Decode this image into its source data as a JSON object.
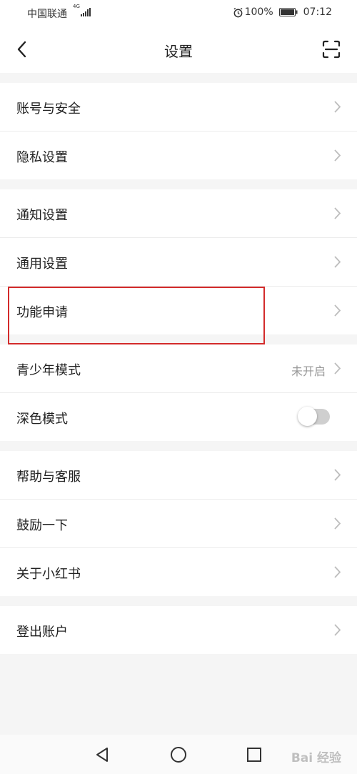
{
  "status_bar": {
    "carrier": "中国联通",
    "network": "4G",
    "battery": "100%",
    "time": "07:12"
  },
  "header": {
    "title": "设置"
  },
  "groups": [
    {
      "items": [
        {
          "label": "账号与安全"
        },
        {
          "label": "隐私设置"
        }
      ]
    },
    {
      "items": [
        {
          "label": "通知设置"
        },
        {
          "label": "通用设置"
        },
        {
          "label": "功能申请"
        }
      ]
    },
    {
      "items": [
        {
          "label": "青少年模式",
          "value": "未开启"
        },
        {
          "label": "深色模式",
          "toggle": false
        }
      ]
    },
    {
      "items": [
        {
          "label": "帮助与客服"
        },
        {
          "label": "鼓励一下"
        },
        {
          "label": "关于小红书"
        }
      ]
    },
    {
      "items": [
        {
          "label": "登出账户"
        }
      ]
    }
  ],
  "highlight_color": "#d32b2b",
  "watermark": "Bai 经验",
  "icons": [
    "back-icon",
    "scan-icon",
    "chevron-right-icon",
    "nav-back-icon",
    "nav-home-icon",
    "nav-recent-icon",
    "alarm-icon",
    "battery-icon",
    "signal-icon"
  ]
}
